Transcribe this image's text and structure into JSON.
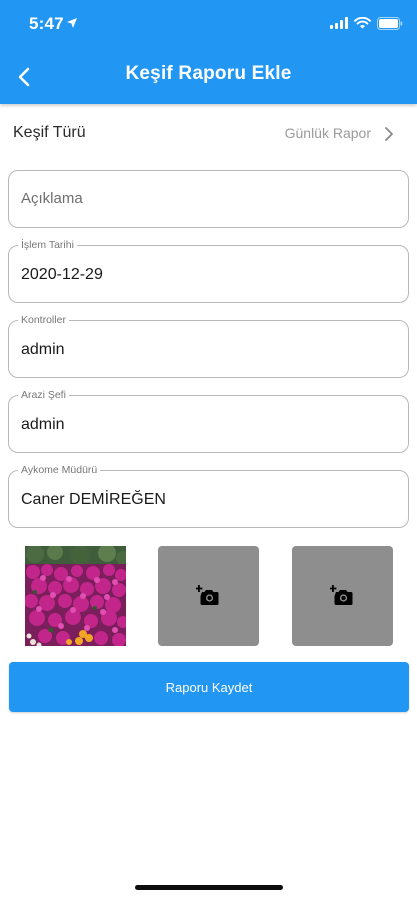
{
  "status_bar": {
    "time": "5:47"
  },
  "app_bar": {
    "title": "Keşif Raporu Ekle",
    "back_icon": "chevron-left-icon"
  },
  "report_type": {
    "label": "Keşif Türü",
    "value": "Günlük Rapor",
    "icon": "chevron-right-icon"
  },
  "fields": {
    "aciklama": {
      "placeholder": "Açıklama",
      "value": ""
    },
    "islem_tarihi": {
      "label": "İşlem Tarihi",
      "value": "2020-12-29"
    },
    "kontroller": {
      "label": "Kontroller",
      "value": "admin"
    },
    "arazi_sefi": {
      "label": "Arazi Şefi",
      "value": "admin"
    },
    "aykome_muduru": {
      "label": "Aykome Müdürü",
      "value": "Caner DEMİREĞEN"
    }
  },
  "photos": [
    {
      "state": "filled",
      "content": "flowers"
    },
    {
      "state": "empty",
      "icon": "add-photo-icon"
    },
    {
      "state": "empty",
      "icon": "add-photo-icon"
    }
  ],
  "save_button": {
    "label": "Raporu Kaydet"
  },
  "colors": {
    "primary": "#2196f3",
    "placeholder_tile": "#8e8e8e",
    "field_border": "#b8b8b8"
  }
}
